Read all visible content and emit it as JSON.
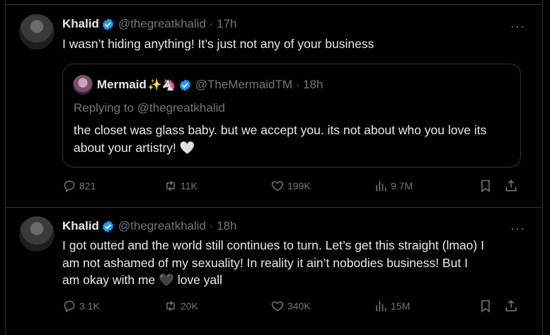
{
  "tweets": [
    {
      "name": "Khalid",
      "handle": "@thegreatkhalid · 17h",
      "text": "I wasn’t hiding anything! It’s just not any of your business",
      "quote": {
        "name": "Mermaid",
        "emojis": "✨🦄",
        "handle": "@TheMermaidTM · 18h",
        "replying_to_label": "Replying to",
        "replying_to_handle": "@thegreatkhalid",
        "text": "the closet was glass baby. but we accept you. its not about who you love its about your artistry!",
        "emoji_end": "🤍"
      },
      "stats": {
        "replies": "821",
        "retweets": "11K",
        "likes": "199K",
        "views": "9.7M"
      }
    },
    {
      "name": "Khalid",
      "handle": "@thegreatkhalid · 18h",
      "text_before": "I got outted and the world still continues to turn. Let’s get this straight (lmao) I am not ashamed of my sexuality! In reality it ain’t nobodies business! But I am okay with me",
      "heart": "🖤",
      "text_after": "love yall",
      "stats": {
        "replies": "3.1K",
        "retweets": "20K",
        "likes": "340K",
        "views": "15M"
      }
    }
  ],
  "ui": {
    "more_glyph": "···",
    "verified_color": "#1d9bf0"
  }
}
